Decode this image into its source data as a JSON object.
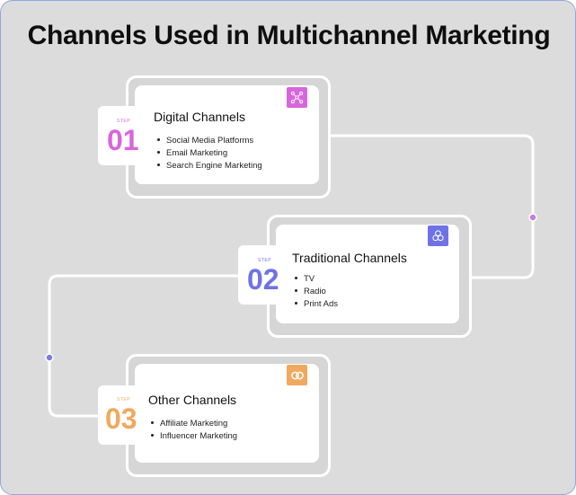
{
  "title": "Channels Used in Multichannel Marketing",
  "steps": [
    {
      "label": "STEP",
      "number": "01",
      "heading": "Digital Channels",
      "items": [
        "Social Media Platforms",
        "Email Marketing",
        "Search Engine Marketing"
      ],
      "color": "#d766dc",
      "icon": "network-icon"
    },
    {
      "label": "STEP",
      "number": "02",
      "heading": "Traditional Channels",
      "items": [
        "TV",
        "Radio",
        "Print Ads"
      ],
      "color": "#6f72e6",
      "icon": "flower-icon"
    },
    {
      "label": "STEP",
      "number": "03",
      "heading": "Other Channels",
      "items": [
        "Affiliate Marketing",
        "Influencer Marketing"
      ],
      "color": "#f0a95e",
      "icon": "rings-icon"
    }
  ],
  "connector_dot_colors": [
    "#c77ddb",
    "#7a7de0"
  ]
}
